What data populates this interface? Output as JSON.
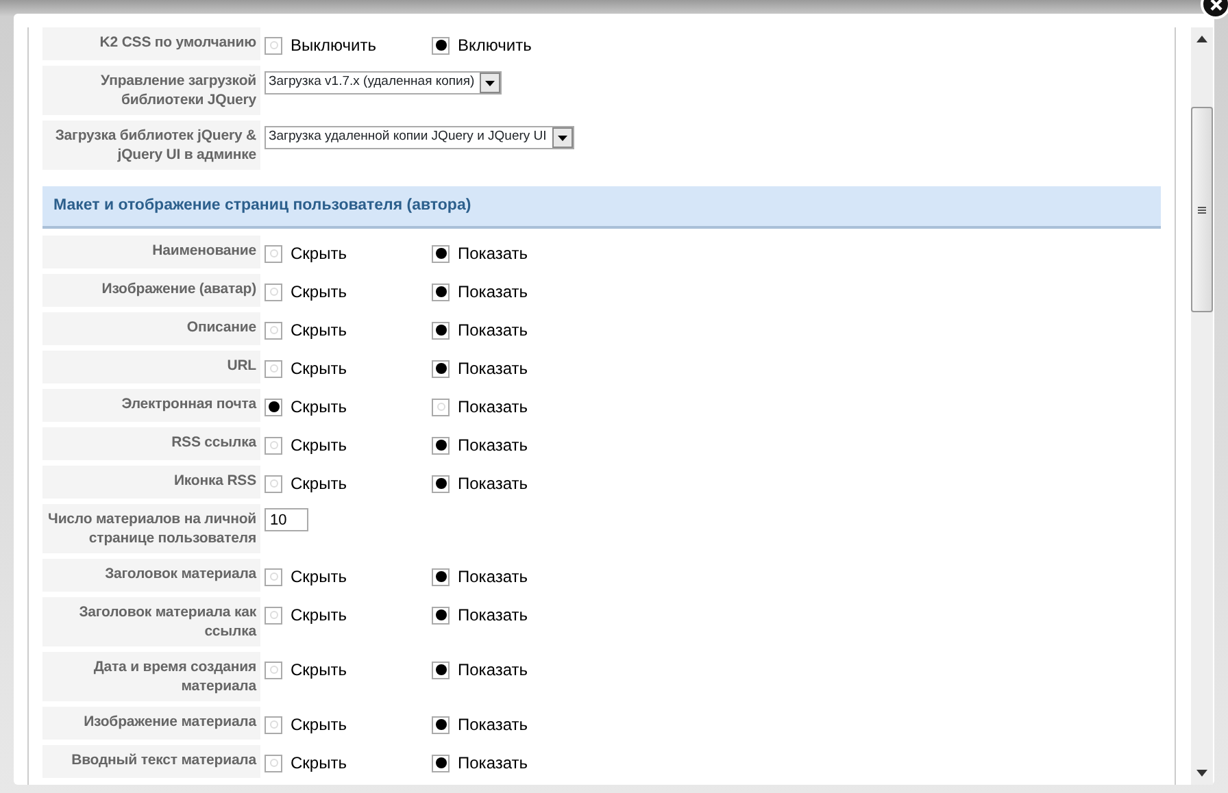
{
  "rows": [
    {
      "kind": "radio",
      "label": "K2 CSS по умолчанию",
      "options": [
        {
          "label": "Выключить",
          "selected": false
        },
        {
          "label": "Включить",
          "selected": true
        }
      ]
    },
    {
      "kind": "select",
      "label": "Управление загрузкой библиотеки JQuery",
      "value": "Загрузка v1.7.x (удаленная копия)"
    },
    {
      "kind": "select",
      "label": "Загрузка библиотек jQuery & jQuery UI в админке",
      "value": "Загрузка удаленной копии JQuery и JQuery UI"
    },
    {
      "kind": "section",
      "label": "Макет и отображение страниц пользователя (автора)"
    },
    {
      "kind": "radio",
      "label": "Наименование",
      "options": [
        {
          "label": "Скрыть",
          "selected": false
        },
        {
          "label": "Показать",
          "selected": true
        }
      ]
    },
    {
      "kind": "radio",
      "label": "Изображение (аватар)",
      "options": [
        {
          "label": "Скрыть",
          "selected": false
        },
        {
          "label": "Показать",
          "selected": true
        }
      ]
    },
    {
      "kind": "radio",
      "label": "Описание",
      "options": [
        {
          "label": "Скрыть",
          "selected": false
        },
        {
          "label": "Показать",
          "selected": true
        }
      ]
    },
    {
      "kind": "radio",
      "label": "URL",
      "options": [
        {
          "label": "Скрыть",
          "selected": false
        },
        {
          "label": "Показать",
          "selected": true
        }
      ]
    },
    {
      "kind": "radio",
      "label": "Электронная почта",
      "options": [
        {
          "label": "Скрыть",
          "selected": true
        },
        {
          "label": "Показать",
          "selected": false
        }
      ]
    },
    {
      "kind": "radio",
      "label": "RSS ссылка",
      "options": [
        {
          "label": "Скрыть",
          "selected": false
        },
        {
          "label": "Показать",
          "selected": true
        }
      ]
    },
    {
      "kind": "radio",
      "label": "Иконка RSS",
      "options": [
        {
          "label": "Скрыть",
          "selected": false
        },
        {
          "label": "Показать",
          "selected": true
        }
      ]
    },
    {
      "kind": "input",
      "label": "Число материалов на личной странице пользователя",
      "value": "10"
    },
    {
      "kind": "radio",
      "label": "Заголовок материала",
      "options": [
        {
          "label": "Скрыть",
          "selected": false
        },
        {
          "label": "Показать",
          "selected": true
        }
      ]
    },
    {
      "kind": "radio",
      "label": "Заголовок материала как ссылка",
      "options": [
        {
          "label": "Скрыть",
          "selected": false
        },
        {
          "label": "Показать",
          "selected": true
        }
      ]
    },
    {
      "kind": "radio",
      "label": "Дата и время создания материала",
      "options": [
        {
          "label": "Скрыть",
          "selected": false
        },
        {
          "label": "Показать",
          "selected": true
        }
      ]
    },
    {
      "kind": "radio",
      "label": "Изображение материала",
      "options": [
        {
          "label": "Скрыть",
          "selected": false
        },
        {
          "label": "Показать",
          "selected": true
        }
      ]
    },
    {
      "kind": "radio",
      "label": "Вводный текст материала",
      "options": [
        {
          "label": "Скрыть",
          "selected": false
        },
        {
          "label": "Показать",
          "selected": true
        }
      ]
    }
  ]
}
